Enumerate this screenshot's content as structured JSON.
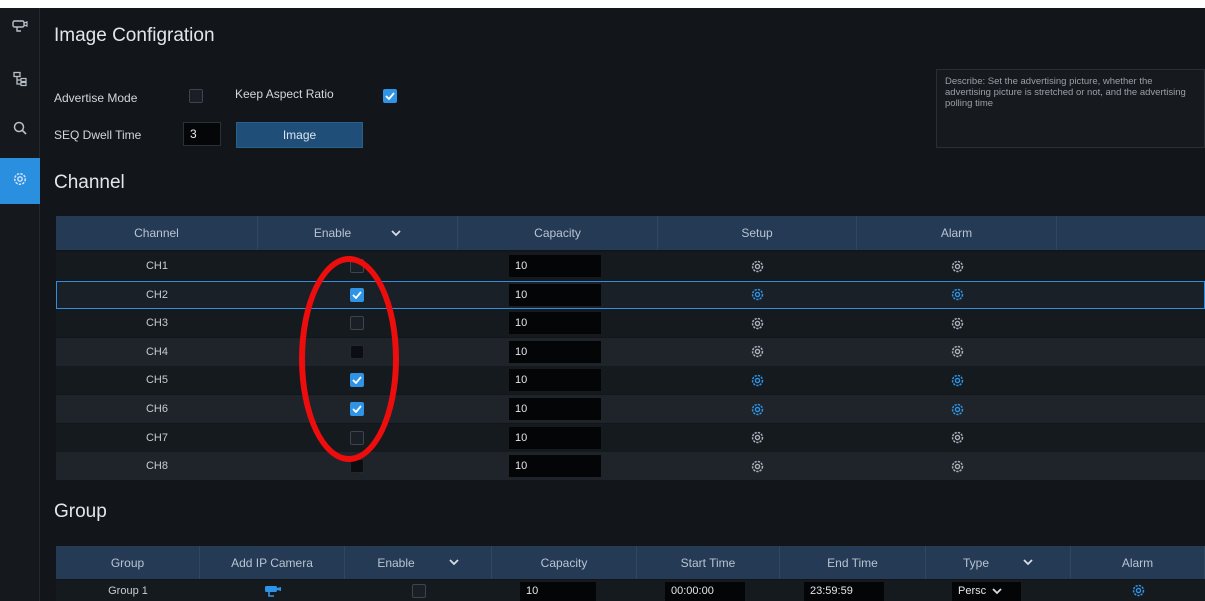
{
  "sidebar": {
    "items": [
      {
        "name": "camera",
        "icon": "camera-icon",
        "active": false
      },
      {
        "name": "network",
        "icon": "network-tree-icon",
        "active": false
      },
      {
        "name": "search",
        "icon": "search-icon",
        "active": false
      },
      {
        "name": "settings",
        "icon": "gear-icon",
        "active": true
      }
    ]
  },
  "page_title": "Image Configration",
  "advertise": {
    "advertise_mode_label": "Advertise Mode",
    "advertise_mode_checked": false,
    "keep_aspect_label": "Keep Aspect Ratio",
    "keep_aspect_checked": true,
    "seq_dwell_label": "SEQ Dwell Time",
    "seq_dwell_value": "3",
    "image_button": "Image"
  },
  "description": "Describe: Set the advertising picture, whether the advertising picture is stretched or not, and the advertising polling time",
  "channel_section": {
    "title": "Channel",
    "headers": {
      "channel": "Channel",
      "enable": "Enable",
      "capacity": "Capacity",
      "setup": "Setup",
      "alarm": "Alarm"
    },
    "rows": [
      {
        "channel": "CH1",
        "enabled": false,
        "capacity": "10",
        "active": false
      },
      {
        "channel": "CH2",
        "enabled": true,
        "capacity": "10",
        "active": true
      },
      {
        "channel": "CH3",
        "enabled": false,
        "capacity": "10",
        "active": false
      },
      {
        "channel": "CH4",
        "enabled": false,
        "capacity": "10",
        "active": false
      },
      {
        "channel": "CH5",
        "enabled": true,
        "capacity": "10",
        "active": true
      },
      {
        "channel": "CH6",
        "enabled": true,
        "capacity": "10",
        "active": true
      },
      {
        "channel": "CH7",
        "enabled": false,
        "capacity": "10",
        "active": false
      },
      {
        "channel": "CH8",
        "enabled": false,
        "capacity": "10",
        "active": false
      }
    ],
    "selected_row": "CH2"
  },
  "group_section": {
    "title": "Group",
    "headers": {
      "group": "Group",
      "add_ip_camera": "Add IP Camera",
      "enable": "Enable",
      "capacity": "Capacity",
      "start_time": "Start Time",
      "end_time": "End Time",
      "type": "Type",
      "alarm": "Alarm"
    },
    "rows": [
      {
        "group": "Group 1",
        "enabled": false,
        "capacity": "10",
        "start_time": "00:00:00",
        "end_time": "23:59:59",
        "type": "Persc"
      }
    ]
  },
  "colors": {
    "accent": "#2f94e6",
    "annotation": "#ee0d0d",
    "header": "#243a55"
  }
}
